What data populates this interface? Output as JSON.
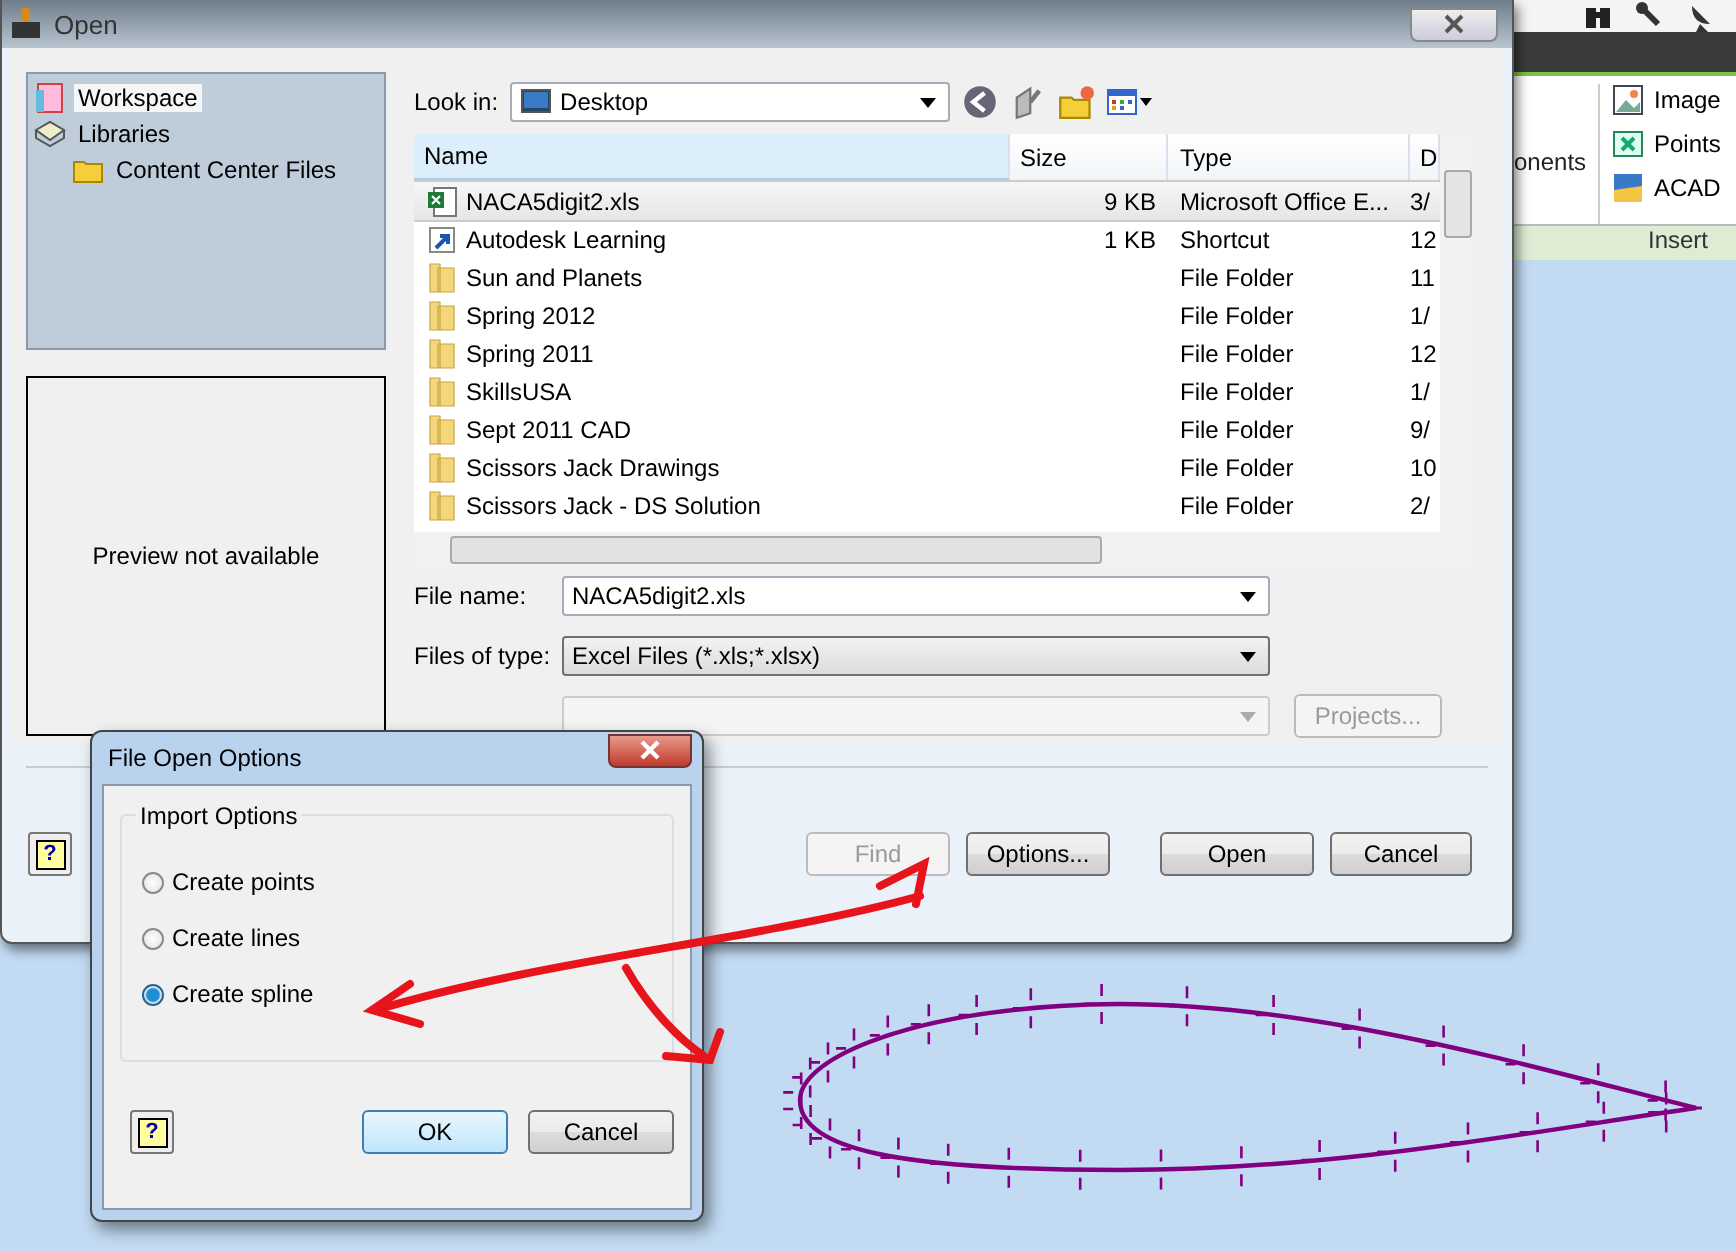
{
  "open_dialog": {
    "title": "Open",
    "places": [
      {
        "label": "Workspace",
        "kind": "workspace",
        "selected": true
      },
      {
        "label": "Libraries",
        "kind": "libraries",
        "selected": false,
        "children": [
          {
            "label": "Content Center Files",
            "kind": "folder",
            "selected": false
          }
        ]
      }
    ],
    "help_button": "?",
    "preview_text": "Preview not available",
    "look_in": {
      "label": "Look in:",
      "value": "Desktop"
    },
    "columns": [
      "Name",
      "Size",
      "Type",
      "D"
    ],
    "rows": [
      {
        "name": "NACA5digit2.xls",
        "size": "9 KB",
        "type": "Microsoft Office E...",
        "column_4": "3/",
        "kind": "excel",
        "selected": true
      },
      {
        "name": "Autodesk Learning",
        "size": "1 KB",
        "type": "Shortcut",
        "column_4": "12",
        "kind": "shortcut",
        "selected": false
      },
      {
        "name": "Sun and Planets",
        "type": "File Folder",
        "column_4": "11",
        "kind": "folder",
        "selected": false
      },
      {
        "name": "Spring 2012",
        "type": "File Folder",
        "column_4": "1/",
        "kind": "folder",
        "selected": false
      },
      {
        "name": "Spring 2011",
        "type": "File Folder",
        "column_4": "12",
        "kind": "folder",
        "selected": false
      },
      {
        "name": "SkillsUSA",
        "type": "File Folder",
        "column_4": "1/",
        "kind": "folder",
        "selected": false
      },
      {
        "name": "Sept 2011 CAD",
        "type": "File Folder",
        "column_4": "9/",
        "kind": "folder",
        "selected": false
      },
      {
        "name": "Scissors Jack Drawings",
        "type": "File Folder",
        "column_4": "10",
        "kind": "folder",
        "selected": false
      },
      {
        "name": "Scissors Jack - DS Solution",
        "type": "File Folder",
        "column_4": "2/",
        "kind": "folder",
        "selected": false
      }
    ],
    "file_name": {
      "label": "File name:",
      "value": "NACA5digit2.xls"
    },
    "files_of_type": {
      "label": "Files of type:",
      "value": "Excel Files (*.xls;*.xlsx)"
    },
    "projects_button": {
      "label": "Projects...",
      "disabled": true
    },
    "buttons": [
      {
        "label": "Find",
        "disabled": true
      },
      {
        "label": "Options...",
        "disabled": false
      },
      {
        "label": "Open",
        "disabled": false
      },
      {
        "label": "Cancel",
        "disabled": false
      }
    ]
  },
  "options_dialog": {
    "title": "File Open Options",
    "group_title": "Import Options",
    "help_button": "?",
    "options": [
      {
        "label": "Create points",
        "selected": false
      },
      {
        "label": "Create lines",
        "selected": false
      },
      {
        "label": "Create spline",
        "selected": true
      }
    ],
    "buttons": [
      {
        "label": "OK",
        "default": true
      },
      {
        "label": "Cancel",
        "default": false
      }
    ]
  },
  "ribbon": {
    "partial_label": "onents",
    "items": [
      {
        "label": "Image",
        "kind": "image"
      },
      {
        "label": "Points",
        "kind": "points"
      },
      {
        "label": "ACAD",
        "kind": "acad"
      }
    ],
    "panel_label": "Insert"
  }
}
